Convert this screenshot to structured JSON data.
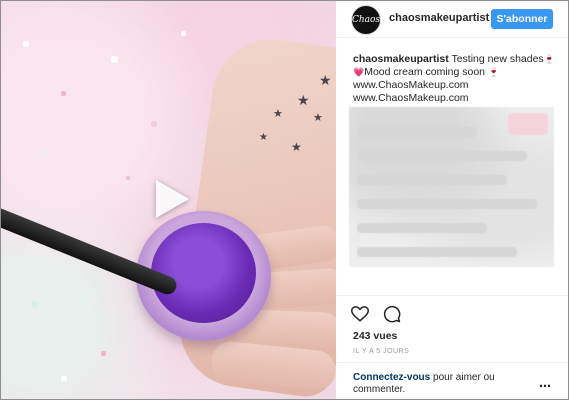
{
  "post": {
    "username": "chaosmakeupartist",
    "avatar_text": "Chaos",
    "follow_label": "S'abonner",
    "caption_user": "chaosmakeupartist",
    "caption_line1": "Testing new shades",
    "caption_emoji_1": "🍷",
    "caption_emoji_2": "💗",
    "caption_line2": "Mood cream coming soon",
    "caption_emoji_3": "🍷",
    "links": [
      "www.ChaosMakeup.com",
      "www.ChaosMakeup.com"
    ],
    "views": "243 vues",
    "time_ago": "IL Y A 5 JOURS",
    "login_link": "Connectez-vous",
    "login_suffix": " pour aimer ou commenter.",
    "more_icon": "⋯"
  },
  "icons": {
    "play": "play-icon",
    "like": "heart-icon",
    "comment": "comment-icon",
    "more": "more-options-icon"
  },
  "colors": {
    "follow_button": "#3897f0",
    "login_link": "#003569",
    "jar_purple": "#6a2bb5",
    "background_pink": "#f6dde8"
  }
}
